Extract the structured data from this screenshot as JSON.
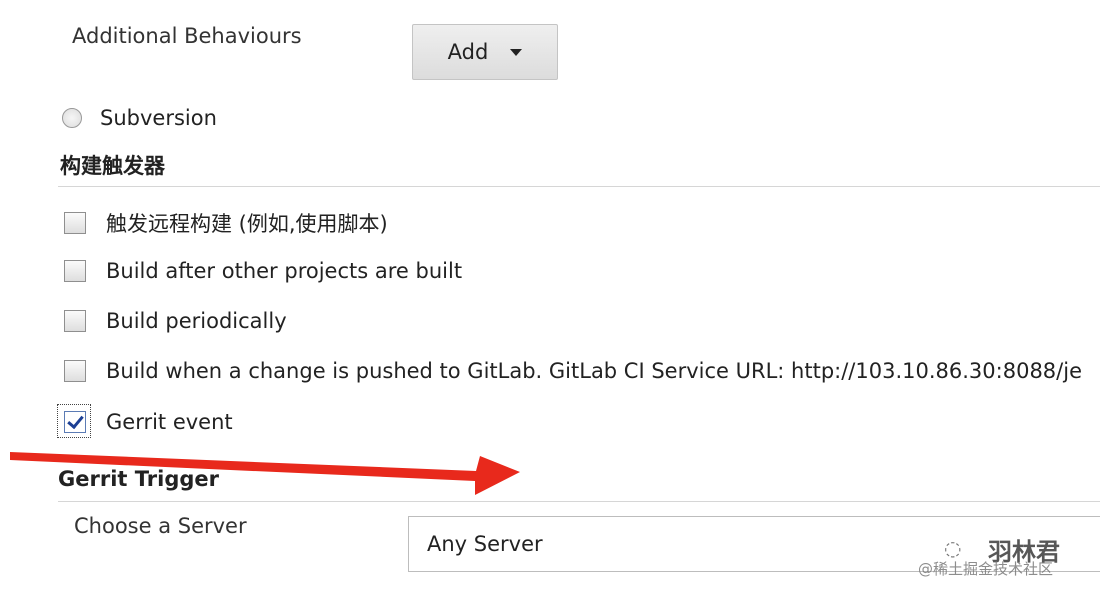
{
  "scm": {
    "additional_behaviours_label": "Additional Behaviours",
    "add_button_label": "Add",
    "subversion_label": "Subversion"
  },
  "build_triggers": {
    "title": "构建触发器",
    "items": [
      {
        "label": "触发远程构建 (例如,使用脚本)",
        "checked": false
      },
      {
        "label": "Build after other projects are built",
        "checked": false
      },
      {
        "label": "Build periodically",
        "checked": false
      },
      {
        "label": "Build when a change is pushed to GitLab. GitLab CI Service URL: http://103.10.86.30:8088/je",
        "checked": false
      },
      {
        "label": "Gerrit event",
        "checked": true
      }
    ]
  },
  "gerrit_trigger": {
    "title": "Gerrit Trigger",
    "choose_server_label": "Choose a Server",
    "server_value": "Any Server"
  },
  "watermark": {
    "main": "羽林君",
    "sub": "@稀土掘金技术社区"
  },
  "colors": {
    "arrow": "#e8291c",
    "checkmark": "#1c3f94"
  }
}
